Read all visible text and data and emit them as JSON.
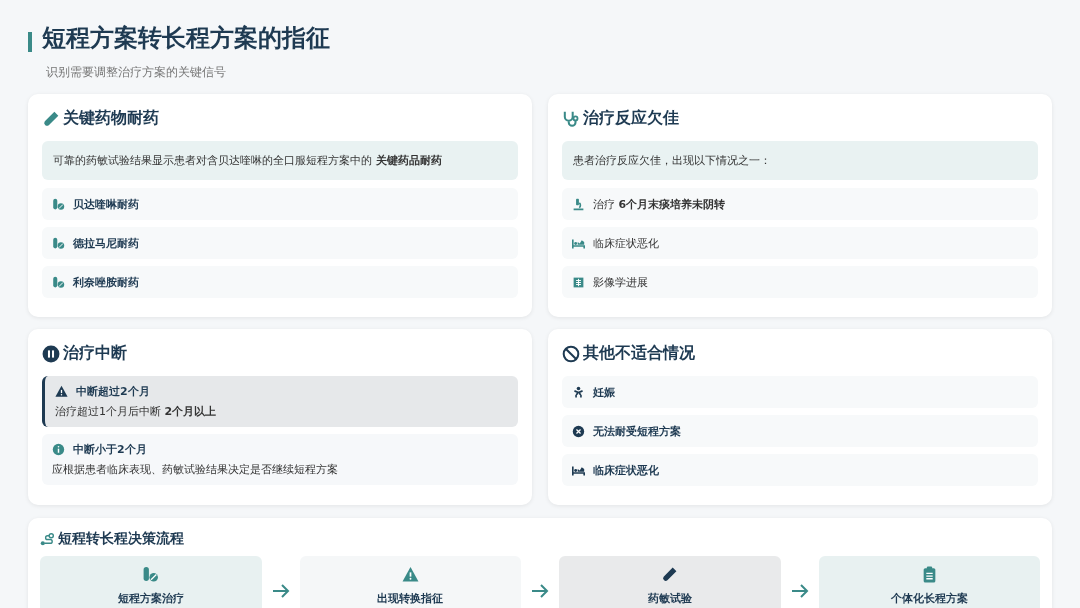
{
  "title": "短程方案转长程方案的指征",
  "subtitle": "识别需要调整治疗方案的关键信号",
  "cards": [
    {
      "kind": "list",
      "title": "关键药物耐药",
      "intro": "可靠的药敏试验结果显示患者对含贝达喹啉的全口服短程方案中的 **关键药品耐药**",
      "bold_items": true,
      "items": [
        "贝达喹啉耐药",
        "德拉马尼耐药",
        "利奈唑胺耐药"
      ]
    },
    {
      "kind": "list",
      "title": "治疗反应欠佳",
      "intro": "患者治疗反应欠佳，出现以下情况之一：",
      "bold_items": false,
      "items": [
        "治疗 **6个月末痰培养未阴转**",
        "临床症状恶化",
        "影像学进展"
      ]
    },
    {
      "kind": "alerts",
      "title": "治疗中断",
      "alerts": [
        {
          "kind": "warning",
          "title": "中断超过2个月",
          "text": "治疗超过1个月后中断 **2个月以上**"
        },
        {
          "kind": "info",
          "title": "中断小于2个月",
          "text": "应根据患者临床表现、药敏试验结果决定是否继续短程方案"
        }
      ]
    },
    {
      "kind": "list",
      "title": "其他不适合情况",
      "bold_items": true,
      "items": [
        "妊娠",
        "无法耐受短程方案",
        "临床症状恶化"
      ]
    }
  ],
  "flow": {
    "title": "短程转长程决策流程",
    "steps": [
      {
        "label": "短程方案治疗",
        "color": "#e8f1f1"
      },
      {
        "label": "出现转换指征",
        "color": "#f5f7f8"
      },
      {
        "label": "药敏试验",
        "color": "#e9eaeb"
      },
      {
        "label": "个体化长程方案",
        "color": "#e8f1f1"
      }
    ]
  }
}
